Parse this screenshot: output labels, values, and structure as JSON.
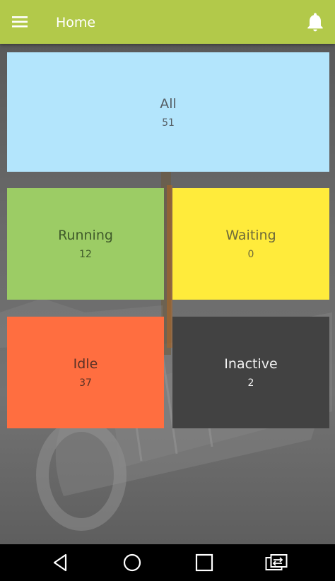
{
  "appbar": {
    "title": "Home",
    "menu_icon": "menu-icon",
    "notification_icon": "bell-icon",
    "color": "#b2c94a"
  },
  "tiles": [
    {
      "label": "All",
      "count": "51",
      "color": "#b3e5fc"
    },
    {
      "label": "Running",
      "count": "12",
      "color": "#9ccc65"
    },
    {
      "label": "Waiting",
      "count": "0",
      "color": "#ffeb3b"
    },
    {
      "label": "Idle",
      "count": "37",
      "color": "#ff6e40"
    },
    {
      "label": "Inactive",
      "count": "2",
      "color": "#424242"
    }
  ],
  "navbar": {
    "buttons": [
      "back-icon",
      "home-icon",
      "recents-icon",
      "screen-switch-icon"
    ]
  }
}
